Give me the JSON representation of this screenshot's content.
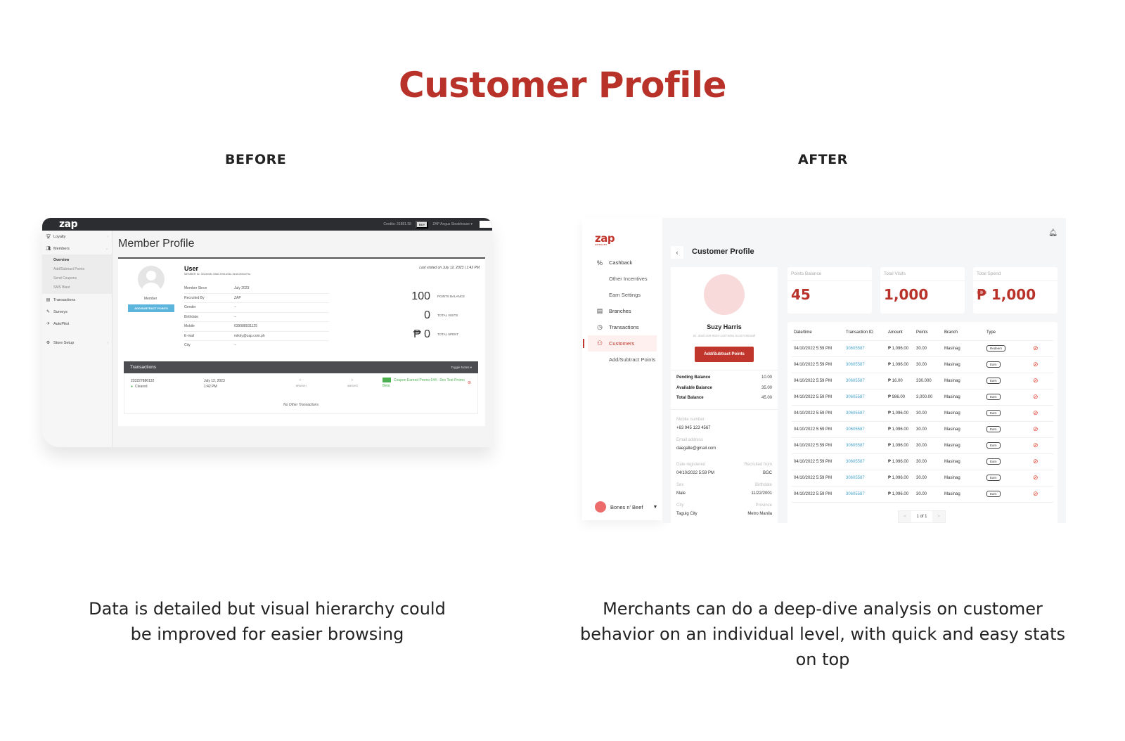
{
  "page": {
    "title": "Customer Profile",
    "before_label": "BEFORE",
    "after_label": "AFTER",
    "before_caption": "Data is detailed but visual hierarchy could be improved for easier browsing",
    "after_caption": "Merchants can do a deep-dive analysis on customer behavior on an individual level, with quick and easy stats on top",
    "accent_color": "#b8322a"
  },
  "before": {
    "topbar": {
      "logo": "zap",
      "credits": "Credits: 31881.58",
      "buy_label": "BUY",
      "store": "ZAP Angus Steakhouse"
    },
    "sidebar": {
      "items": [
        {
          "label": "Loyalty",
          "icon": "trophy-icon"
        },
        {
          "label": "Members",
          "icon": "users-icon"
        },
        {
          "label": "Transactions",
          "icon": "list-icon"
        },
        {
          "label": "Surveys",
          "icon": "survey-icon"
        },
        {
          "label": "AutoPilot",
          "icon": "plane-icon"
        },
        {
          "label": "Store Setup",
          "icon": "gear-icon"
        }
      ],
      "members_sub": [
        "Overview",
        "Add/Subtract Points",
        "Send Coupons",
        "SMS Blast"
      ]
    },
    "title": "Member Profile",
    "member_label": "Member",
    "add_points_label": "ADD/SUBTRACT POINTS",
    "user_name": "User",
    "member_id": "MEMBER ID: 4b23e54f-33bb-49fd-b06c-5e4e1659d79a",
    "last_visited": "Last visited on July 12, 2023 | 1:42 PM",
    "fields": [
      {
        "label": "Member Since",
        "value": "July 2023"
      },
      {
        "label": "Recruited By",
        "value": "ZAP"
      },
      {
        "label": "Gender",
        "value": "--"
      },
      {
        "label": "Birthdate",
        "value": "--"
      },
      {
        "label": "Mobile",
        "value": "639088931125"
      },
      {
        "label": "E-mail",
        "value": "mikky@zap.com.ph"
      },
      {
        "label": "City",
        "value": "--"
      }
    ],
    "stats": [
      {
        "value": "100",
        "label": "POINTS BALANCE"
      },
      {
        "value": "0",
        "label": "TOTAL VISITS"
      },
      {
        "value": "₱ 0",
        "label": "TOTAL SPENT"
      }
    ],
    "transactions": {
      "title": "Transactions",
      "toggle_label": "Toggle Notes ▾",
      "row": {
        "id": "233227886132",
        "status": "Cleared",
        "date": "July 12, 2023",
        "time": "1:42 PM",
        "branch_value": "--",
        "branch_label": "BRANCH",
        "amount_value": "--",
        "amount_label": "AMOUNT",
        "note": "Coupon Earned Promo 644 - Dev Test Promo Beta"
      },
      "empty": "No Other Transactions"
    }
  },
  "after": {
    "logo": "zap",
    "logo_sub": "LOYALTY",
    "nav": [
      {
        "label": "Cashback",
        "icon": "percent-icon",
        "sub": false,
        "active": false
      },
      {
        "label": "Other Incentives",
        "sub": true,
        "active": false
      },
      {
        "label": "Earn Settings",
        "sub": true,
        "active": false
      },
      {
        "label": "Branches",
        "icon": "store-icon",
        "sub": false,
        "active": false
      },
      {
        "label": "Transactions",
        "icon": "clock-icon",
        "sub": false,
        "active": false
      },
      {
        "label": "Customers",
        "icon": "customers-icon",
        "sub": false,
        "active": true
      },
      {
        "label": "Add/Subtract Points",
        "sub": true,
        "active": false
      }
    ],
    "store": "Bones n' Beef",
    "title": "Customer Profile",
    "profile": {
      "name": "Suzy Harris",
      "id": "ID: d8efc4e8-6929-444f-9d91-5cc874853a8f",
      "add_points_label": "Add/Subtract Points",
      "balances": [
        {
          "label": "Pending Balance",
          "value": "10.00"
        },
        {
          "label": "Available Balance",
          "value": "35.00"
        },
        {
          "label": "Total Balance",
          "value": "45.00"
        }
      ],
      "mobile_label": "Mobile number",
      "mobile": "+63 945 123 4567",
      "email_label": "Email address",
      "email": "daegalle@gmail.com",
      "date_registered_label": "Date registered",
      "date_registered": "04/10/2022 5:59 PM",
      "recruited_from_label": "Recruited from",
      "recruited_from": "BGC",
      "sex_label": "Sex",
      "sex": "Male",
      "birthdate_label": "Birthdate",
      "birthdate": "11/22/2001",
      "city_label": "City",
      "city": "Taguig City",
      "province_label": "Province",
      "province": "Metro Manila"
    },
    "stats": [
      {
        "label": "Points Balance",
        "value": "45"
      },
      {
        "label": "Total Visits",
        "value": "1,000"
      },
      {
        "label": "Total Spend",
        "value": "₱ 1,000"
      }
    ],
    "table": {
      "headers": [
        "Date/time",
        "Transaction ID",
        "Amount",
        "Points",
        "Branch",
        "Type",
        ""
      ],
      "rows": [
        {
          "date": "04/10/2022 5:59 PM",
          "id": "30605587",
          "amount": "₱ 1,096.00",
          "points": "30.00",
          "branch": "Masinag",
          "type": "Redeem"
        },
        {
          "date": "04/10/2022 5:59 PM",
          "id": "30605587",
          "amount": "₱ 1,096.00",
          "points": "30.00",
          "branch": "Masinag",
          "type": "Earn"
        },
        {
          "date": "04/10/2022 5:59 PM",
          "id": "30605587",
          "amount": "₱ 16.00",
          "points": "330.000",
          "branch": "Masinag",
          "type": "Earn"
        },
        {
          "date": "04/10/2022 5:59 PM",
          "id": "30605587",
          "amount": "₱ 986.00",
          "points": "3,000.00",
          "branch": "Masinag",
          "type": "Earn"
        },
        {
          "date": "04/10/2022 5:59 PM",
          "id": "30605587",
          "amount": "₱ 1,096.00",
          "points": "30.00",
          "branch": "Masinag",
          "type": "Earn"
        },
        {
          "date": "04/10/2022 5:59 PM",
          "id": "30605587",
          "amount": "₱ 1,096.00",
          "points": "30.00",
          "branch": "Masinag",
          "type": "Earn"
        },
        {
          "date": "04/10/2022 5:59 PM",
          "id": "30605587",
          "amount": "₱ 1,096.00",
          "points": "30.00",
          "branch": "Masinag",
          "type": "Earn"
        },
        {
          "date": "04/10/2022 5:59 PM",
          "id": "30605587",
          "amount": "₱ 1,096.00",
          "points": "30.00",
          "branch": "Masinag",
          "type": "Earn"
        },
        {
          "date": "04/10/2022 5:59 PM",
          "id": "30605587",
          "amount": "₱ 1,096.00",
          "points": "30.00",
          "branch": "Masinag",
          "type": "Earn"
        },
        {
          "date": "04/10/2022 5:59 PM",
          "id": "30605587",
          "amount": "₱ 1,096.00",
          "points": "30.00",
          "branch": "Masinag",
          "type": "Earn"
        }
      ]
    },
    "pager": {
      "prev": "<",
      "current": "1 of 1",
      "next": ">"
    }
  }
}
